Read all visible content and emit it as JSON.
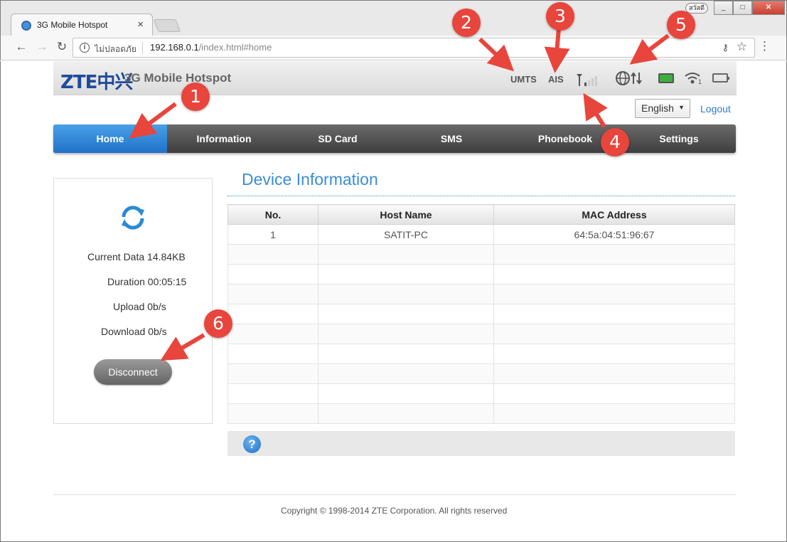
{
  "browser": {
    "tab_title": "3G Mobile Hotspot",
    "tab_close": "×",
    "user_badge": "สวัสดี",
    "window_buttons": [
      "_",
      "□",
      "✕"
    ],
    "back": "←",
    "forward": "→",
    "reload": "↻",
    "info_glyph": "i",
    "security_label": "ไม่ปลอดภัย",
    "url_host": "192.168.0.1",
    "url_path": "/index.html#home",
    "key_glyph": "⚷",
    "star_glyph": "☆",
    "menu_glyph": "⋮"
  },
  "header": {
    "logo": "ZTE中兴",
    "product": "3G Mobile Hotspot",
    "network_type": "UMTS",
    "operator": "AIS",
    "icons": [
      "signal-icon",
      "globe-data-icon",
      "sim-icon",
      "wifi-icon",
      "battery-icon"
    ],
    "wifi_clients": "1"
  },
  "language": {
    "selected": "English",
    "caret": "▼"
  },
  "logout": "Logout",
  "nav": {
    "items": [
      {
        "label": "Home",
        "active": true
      },
      {
        "label": "Information",
        "active": false
      },
      {
        "label": "SD Card",
        "active": false
      },
      {
        "label": "SMS",
        "active": false
      },
      {
        "label": "Phonebook",
        "active": false
      },
      {
        "label": "Settings",
        "active": false
      }
    ]
  },
  "connection": {
    "current_data": "Current Data 14.84KB",
    "duration": "Duration 00:05:15",
    "upload": "Upload 0b/s",
    "download": "Download 0b/s",
    "disconnect": "Disconnect"
  },
  "device_info": {
    "title": "Device Information",
    "columns": [
      "No.",
      "Host Name",
      "MAC Address"
    ],
    "rows": [
      [
        "1",
        "SATIT-PC",
        "64:5a:04:51:96:67"
      ]
    ]
  },
  "help": "?",
  "footer": "Copyright © 1998-2014 ZTE Corporation. All rights reserved",
  "callouts": [
    "1",
    "2",
    "3",
    "4",
    "5",
    "6"
  ],
  "colors": {
    "accent": "#3a8dd6",
    "callout": "#e8453c",
    "nav_active": "#1f72c8"
  }
}
